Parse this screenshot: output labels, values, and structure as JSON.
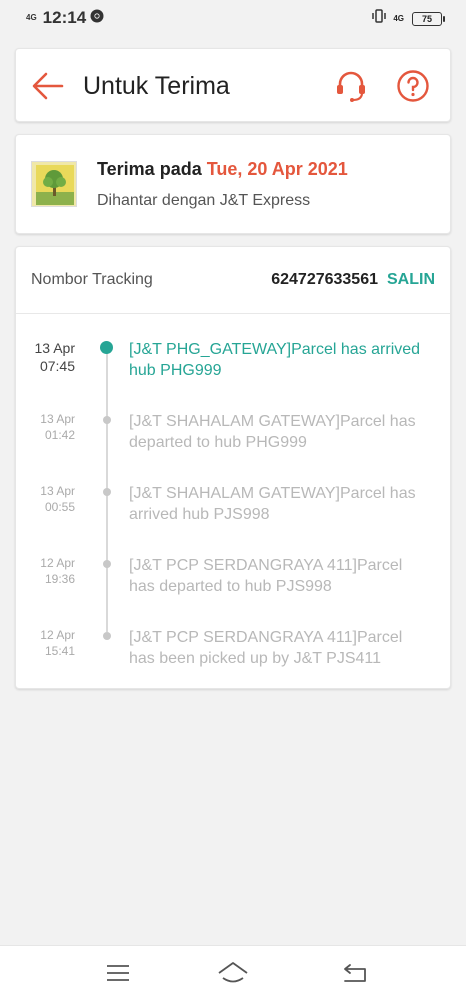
{
  "status": {
    "network": "4G",
    "time": "12:14",
    "right_network": "4G",
    "battery": "75"
  },
  "header": {
    "title": "Untuk Terima"
  },
  "delivery": {
    "receive_label": "Terima pada",
    "receive_date": "Tue, 20 Apr 2021",
    "courier_text": "Dihantar dengan J&T Express"
  },
  "tracking": {
    "label": "Nombor Tracking",
    "number": "624727633561",
    "copy_label": "SALIN",
    "events": [
      {
        "date": "13 Apr",
        "time": "07:45",
        "text": "[J&T PHG_GATEWAY]Parcel has arrived hub PHG999",
        "active": true
      },
      {
        "date": "13 Apr",
        "time": "01:42",
        "text": "[J&T SHAHALAM GATEWAY]Parcel has departed to hub PHG999",
        "active": false
      },
      {
        "date": "13 Apr",
        "time": "00:55",
        "text": "[J&T SHAHALAM GATEWAY]Parcel has arrived hub PJS998",
        "active": false
      },
      {
        "date": "12 Apr",
        "time": "19:36",
        "text": "[J&T PCP SERDANGRAYA 411]Parcel has departed to hub PJS998",
        "active": false
      },
      {
        "date": "12 Apr",
        "time": "15:41",
        "text": "[J&T PCP SERDANGRAYA 411]Parcel has been picked up by J&T PJS411",
        "active": false
      }
    ]
  },
  "colors": {
    "accent": "#e4573d",
    "teal": "#26a595"
  },
  "icons": {
    "back": "arrow-left-icon",
    "support": "headset-icon",
    "help": "question-icon",
    "nav_menu": "menu-icon",
    "nav_home": "home-icon",
    "nav_back": "back-icon"
  }
}
